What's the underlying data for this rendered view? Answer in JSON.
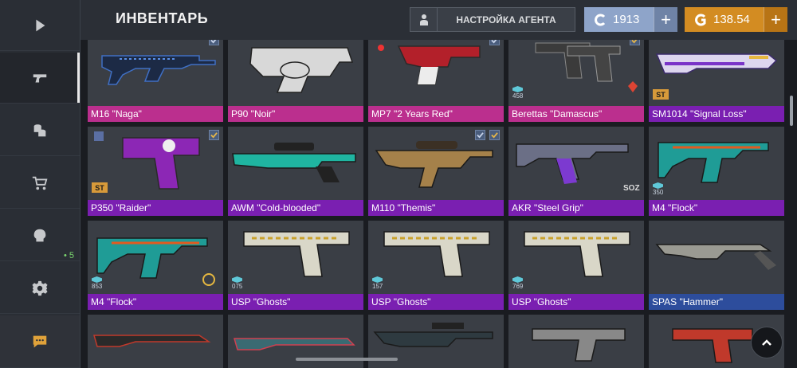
{
  "header": {
    "title": "ИНВЕНТАРЬ",
    "agent_button": "НАСТРОЙКА АГЕНТА",
    "credits": "1913",
    "gold": "138.54"
  },
  "sidebar": {
    "items": [
      {
        "icon": "play-icon"
      },
      {
        "icon": "pistol-icon",
        "active": true
      },
      {
        "icon": "coins-icon"
      },
      {
        "icon": "cart-icon"
      },
      {
        "icon": "skull-icon",
        "badge": "• 5"
      },
      {
        "icon": "gear-icon"
      },
      {
        "icon": "chat-icon"
      }
    ]
  },
  "colors": {
    "pink": "#bb2f8e",
    "purple": "#7a1fb1",
    "blue": "#2d4d9c",
    "credits": "#8ea4c9",
    "gold": "#d38c22"
  },
  "items": [
    {
      "name": "M16 \"Naga\"",
      "rarity": "pink"
    },
    {
      "name": "P90 \"Noir\"",
      "rarity": "pink"
    },
    {
      "name": "MP7 \"2 Years Red\"",
      "rarity": "pink"
    },
    {
      "name": "Berettas \"Damascus\"",
      "rarity": "pink",
      "count": "458"
    },
    {
      "name": "SM1014 \"Signal Loss\"",
      "rarity": "purple",
      "st": "ST"
    },
    {
      "name": "P350 \"Raider\"",
      "rarity": "purple",
      "st": "ST"
    },
    {
      "name": "AWM \"Cold-blooded\"",
      "rarity": "purple"
    },
    {
      "name": "M110 \"Themis\"",
      "rarity": "purple"
    },
    {
      "name": "AKR \"Steel Grip\"",
      "rarity": "purple",
      "tag": "SOZ"
    },
    {
      "name": "M4 \"Flock\"",
      "rarity": "purple",
      "count": "350"
    },
    {
      "name": "M4 \"Flock\"",
      "rarity": "purple",
      "count": "853"
    },
    {
      "name": "USP \"Ghosts\"",
      "rarity": "purple",
      "count": "075"
    },
    {
      "name": "USP \"Ghosts\"",
      "rarity": "purple",
      "count": "157"
    },
    {
      "name": "USP \"Ghosts\"",
      "rarity": "purple",
      "count": "769"
    },
    {
      "name": "SPAS \"Hammer\"",
      "rarity": "blue"
    }
  ]
}
